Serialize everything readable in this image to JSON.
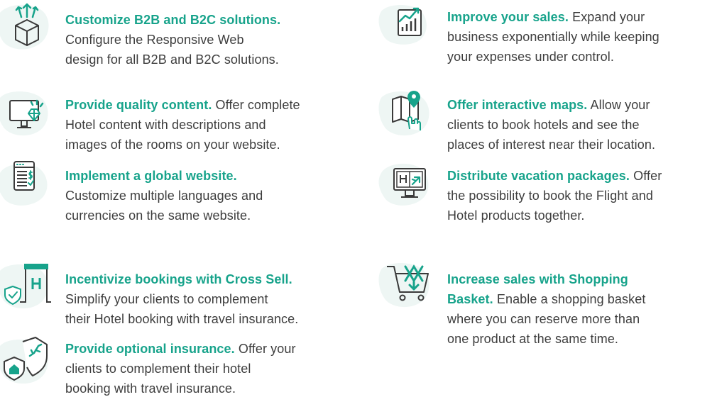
{
  "colors": {
    "accent": "#17a38b",
    "icon_stroke": "#3a3a3a",
    "blob": "#eef6f4",
    "body_text": "#3d3d3d"
  },
  "features": {
    "customize_b2b_b2c": {
      "icon": "box-arrows-icon",
      "title": "Customize B2B and B2C solutions.",
      "line1": "Configure the Responsive Web",
      "line2": "design for all B2B and B2C solutions."
    },
    "improve_sales": {
      "icon": "growth-chart-icon",
      "title": "Improve your sales.",
      "line1": "Expand your",
      "line2": "business exponentially while keeping",
      "line3": "your expenses under control."
    },
    "quality_content": {
      "icon": "monitor-diamond-icon",
      "title": "Provide quality content.",
      "line1": "Offer complete",
      "line2": "Hotel content with descriptions and",
      "line3": "images of the rooms on your website."
    },
    "interactive_maps": {
      "icon": "map-pin-hand-icon",
      "title": "Offer interactive maps.",
      "line1": "Allow your",
      "line2": "clients to book hotels and see the",
      "line3": "places of interest near their location."
    },
    "global_website": {
      "icon": "currency-document-icon",
      "title": "Implement a global website.",
      "line1": "Customize multiple languages and",
      "line2": "currencies on the same website."
    },
    "vacation_packages": {
      "icon": "hotel-flight-monitor-icon",
      "title": "Distribute vacation packages.",
      "line1": "Offer",
      "line2": "the possibility to book the Flight and",
      "line3": "Hotel products together."
    },
    "cross_sell": {
      "icon": "hotel-shield-icon",
      "title": "Incentivize bookings with Cross Sell.",
      "line1": "Simplify your clients to complement",
      "line2": "their Hotel booking with travel insurance."
    },
    "shopping_basket": {
      "icon": "shopping-basket-icon",
      "title": "Increase sales with Shopping",
      "title2": "Basket.",
      "line1": "Enable a shopping basket",
      "line2": "where you can reserve more than",
      "line3": "one product at the same time."
    },
    "optional_insurance": {
      "icon": "insurance-shield-icon",
      "title": "Provide optional insurance.",
      "line1": "Offer your",
      "line2": "clients to complement their hotel",
      "line3": "booking with travel insurance."
    }
  }
}
